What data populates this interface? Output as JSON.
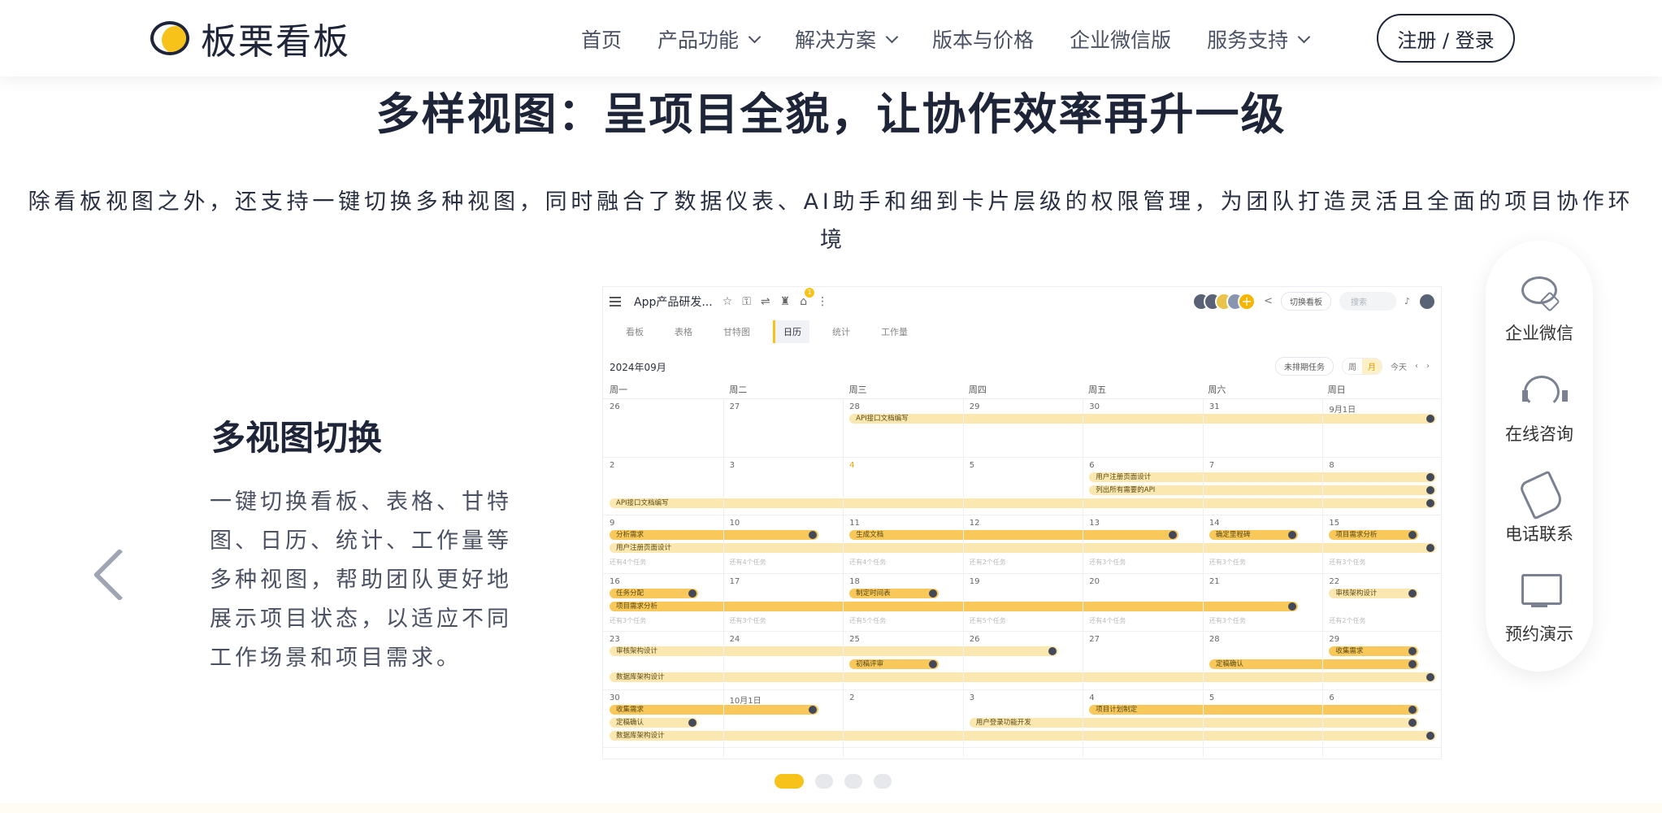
{
  "brand": {
    "name": "板栗看板"
  },
  "nav": {
    "items": [
      {
        "label": "首页",
        "dropdown": false
      },
      {
        "label": "产品功能",
        "dropdown": true
      },
      {
        "label": "解决方案",
        "dropdown": true
      },
      {
        "label": "版本与价格",
        "dropdown": false
      },
      {
        "label": "企业微信版",
        "dropdown": false
      },
      {
        "label": "服务支持",
        "dropdown": true
      }
    ],
    "login_label": "注册 / 登录"
  },
  "hero": {
    "title": "多样视图：呈项目全貌，让协作效率再升一级",
    "subtitle_line1": "除看板视图之外，还支持一键切换多种视图，同时融合了数据仪表、AI助手和细到卡片层级的权限管理，为团队打造灵活且全面的项目协作环",
    "subtitle_line2": "境"
  },
  "feature": {
    "title": "多视图切换",
    "description": "一键切换看板、表格、甘特图、日历、统计、工作量等多种视图，帮助团队更好地展示项目状态，以适应不同工作场景和项目需求。"
  },
  "app": {
    "project_name": "App产品研发...",
    "badge": "1",
    "switch_label": "切换看板",
    "search_placeholder": "搜索",
    "tabs": [
      "看板",
      "表格",
      "甘特图",
      "日历",
      "统计",
      "工作量"
    ],
    "active_tab": "日历",
    "month": "2024年09月",
    "unscheduled": "未排期任务",
    "seg_week": "周",
    "seg_month": "月",
    "today": "今天",
    "weekdays": [
      "周一",
      "周二",
      "周三",
      "周四",
      "周五",
      "周六",
      "周日"
    ],
    "weeks": [
      {
        "days": [
          "26",
          "27",
          "28",
          "29",
          "30",
          "31",
          "9月1日"
        ],
        "more": []
      },
      {
        "days": [
          "2",
          "3",
          "4",
          "5",
          "6",
          "7",
          "8"
        ],
        "more": []
      },
      {
        "days": [
          "9",
          "10",
          "11",
          "12",
          "13",
          "14",
          "15"
        ],
        "more": [
          "还有4个任务",
          "还有4个任务",
          "还有4个任务",
          "还有2个任务",
          "还有3个任务",
          "还有3个任务",
          "还有3个任务"
        ]
      },
      {
        "days": [
          "16",
          "17",
          "18",
          "19",
          "20",
          "21",
          "22"
        ],
        "more": [
          "还有3个任务",
          "还有3个任务",
          "还有5个任务",
          "还有5个任务",
          "还有4个任务",
          "还有3个任务",
          "还有2个任务"
        ]
      },
      {
        "days": [
          "23",
          "24",
          "25",
          "26",
          "27",
          "28",
          "29"
        ],
        "more": []
      },
      {
        "days": [
          "30",
          "10月1日",
          "2",
          "3",
          "4",
          "5",
          "6"
        ],
        "more": []
      }
    ],
    "events": [
      {
        "label": "API接口文档编写",
        "week": 0,
        "start": 2,
        "span": 5,
        "row": 0,
        "strong": false
      },
      {
        "label": "用户注册页面设计",
        "week": 1,
        "start": 4,
        "span": 3,
        "row": 0,
        "strong": false
      },
      {
        "label": "列出所有需要的API",
        "week": 1,
        "start": 4,
        "span": 3,
        "row": 1,
        "strong": false
      },
      {
        "label": "API接口文档编写",
        "week": 1,
        "start": 0,
        "span": 7,
        "row": 2,
        "strong": false
      },
      {
        "label": "分析需求",
        "week": 2,
        "start": 0,
        "span": 1.85,
        "row": 0,
        "strong": true
      },
      {
        "label": "生成文档",
        "week": 2,
        "start": 2,
        "span": 2.85,
        "row": 0,
        "strong": true
      },
      {
        "label": "确定里程碑",
        "week": 2,
        "start": 5,
        "span": 0.85,
        "row": 0,
        "strong": true
      },
      {
        "label": "项目需求分析",
        "week": 2,
        "start": 6,
        "span": 0.85,
        "row": 0,
        "strong": true
      },
      {
        "label": "用户注册页面设计",
        "week": 2,
        "start": 0,
        "span": 7,
        "row": 1,
        "strong": false
      },
      {
        "label": "任务分配",
        "week": 3,
        "start": 0,
        "span": 0.85,
        "row": 0,
        "strong": true
      },
      {
        "label": "制定时间表",
        "week": 3,
        "start": 2,
        "span": 0.85,
        "row": 0,
        "strong": true
      },
      {
        "label": "审核架构设计",
        "week": 3,
        "start": 6,
        "span": 0.85,
        "row": 0,
        "strong": false
      },
      {
        "label": "项目需求分析",
        "week": 3,
        "start": 0,
        "span": 5.85,
        "row": 1,
        "strong": true
      },
      {
        "label": "审核架构设计",
        "week": 4,
        "start": 0,
        "span": 3.85,
        "row": 0,
        "strong": false
      },
      {
        "label": "收集需求",
        "week": 4,
        "start": 6,
        "span": 0.85,
        "row": 0,
        "strong": true
      },
      {
        "label": "初稿评审",
        "week": 4,
        "start": 2,
        "span": 0.85,
        "row": 1,
        "strong": true
      },
      {
        "label": "定稿确认",
        "week": 4,
        "start": 5,
        "span": 1.85,
        "row": 1,
        "strong": true
      },
      {
        "label": "数据库架构设计",
        "week": 4,
        "start": 0,
        "span": 7,
        "row": 2,
        "strong": false
      },
      {
        "label": "收集需求",
        "week": 5,
        "start": 0,
        "span": 1.85,
        "row": 0,
        "strong": true
      },
      {
        "label": "项目计划制定",
        "week": 5,
        "start": 4,
        "span": 2.85,
        "row": 0,
        "strong": true
      },
      {
        "label": "定稿确认",
        "week": 5,
        "start": 0,
        "span": 0.85,
        "row": 1,
        "strong": false
      },
      {
        "label": "用户登录功能开发",
        "week": 5,
        "start": 3,
        "span": 3.85,
        "row": 1,
        "strong": false
      },
      {
        "label": "数据库架构设计",
        "week": 5,
        "start": 0,
        "span": 7,
        "row": 2,
        "strong": false
      }
    ]
  },
  "carousel": {
    "count": 4,
    "active": 0
  },
  "contact": {
    "items": [
      {
        "label": "企业微信",
        "icon": "wechat-work-icon"
      },
      {
        "label": "在线咨询",
        "icon": "headset-icon"
      },
      {
        "label": "电话联系",
        "icon": "phone-icon"
      },
      {
        "label": "预约演示",
        "icon": "monitor-icon"
      }
    ]
  },
  "colors": {
    "accent": "#f7c21a",
    "highlight": "#fde7a0",
    "text": "#1f2538"
  }
}
